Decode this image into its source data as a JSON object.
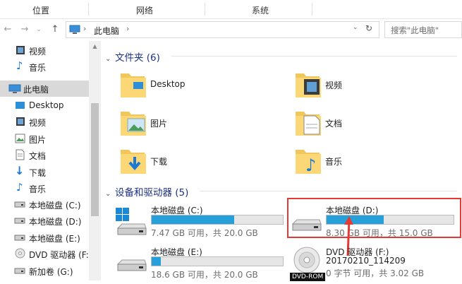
{
  "ribbon": {
    "tabs": [
      "位置",
      "网络",
      "系统"
    ]
  },
  "address": {
    "breadcrumb_root": "此电脑",
    "path": "此电脑",
    "search_placeholder": "搜索\"此电脑\""
  },
  "sidebar": {
    "items": [
      {
        "label": "视频",
        "icon": "video-icon"
      },
      {
        "label": "音乐",
        "icon": "music-icon"
      },
      {
        "label": "此电脑",
        "icon": "computer-icon",
        "selected": true
      },
      {
        "label": "Desktop",
        "icon": "desktop-icon"
      },
      {
        "label": "视频",
        "icon": "video-icon"
      },
      {
        "label": "图片",
        "icon": "picture-icon"
      },
      {
        "label": "文档",
        "icon": "document-icon"
      },
      {
        "label": "下载",
        "icon": "download-icon"
      },
      {
        "label": "音乐",
        "icon": "music-icon"
      },
      {
        "label": "本地磁盘 (C:)",
        "icon": "drive-icon"
      },
      {
        "label": "本地磁盘 (D:)",
        "icon": "drive-icon"
      },
      {
        "label": "本地磁盘 (E:)",
        "icon": "drive-icon"
      },
      {
        "label": "DVD 驱动器 (F:)",
        "icon": "dvd-icon"
      },
      {
        "label": "新加卷 (G:)",
        "icon": "drive-icon"
      }
    ]
  },
  "folders": {
    "header": "文件夹 (6)",
    "items": [
      {
        "label": "Desktop",
        "icon": "desktop-folder-icon"
      },
      {
        "label": "视频",
        "icon": "video-folder-icon"
      },
      {
        "label": "图片",
        "icon": "picture-folder-icon"
      },
      {
        "label": "文档",
        "icon": "document-folder-icon"
      },
      {
        "label": "下载",
        "icon": "download-folder-icon"
      },
      {
        "label": "音乐",
        "icon": "music-folder-icon"
      }
    ]
  },
  "devices": {
    "header": "设备和驱动器 (5)",
    "drives": [
      {
        "name": "本地磁盘 (C:)",
        "info": "7.47 GB 可用，共 20.0 GB",
        "used_fraction": 0.63
      },
      {
        "name": "本地磁盘 (D:)",
        "info": "8.30 GB 可用，共 15.0 GB",
        "used_fraction": 0.45
      },
      {
        "name": "本地磁盘 (E:)",
        "info": "18.6 GB 可用，共 20.0 GB",
        "used_fraction": 0.07
      },
      {
        "name": "DVD 驱动器 (F:)",
        "line2": "20170210_114209",
        "info": "0 字节 可用，共 3.02 GB",
        "tag": "DVD-ROM"
      }
    ]
  },
  "colors": {
    "accent": "#26a0da",
    "highlight": "#e53935",
    "group_header": "#1e3287"
  }
}
